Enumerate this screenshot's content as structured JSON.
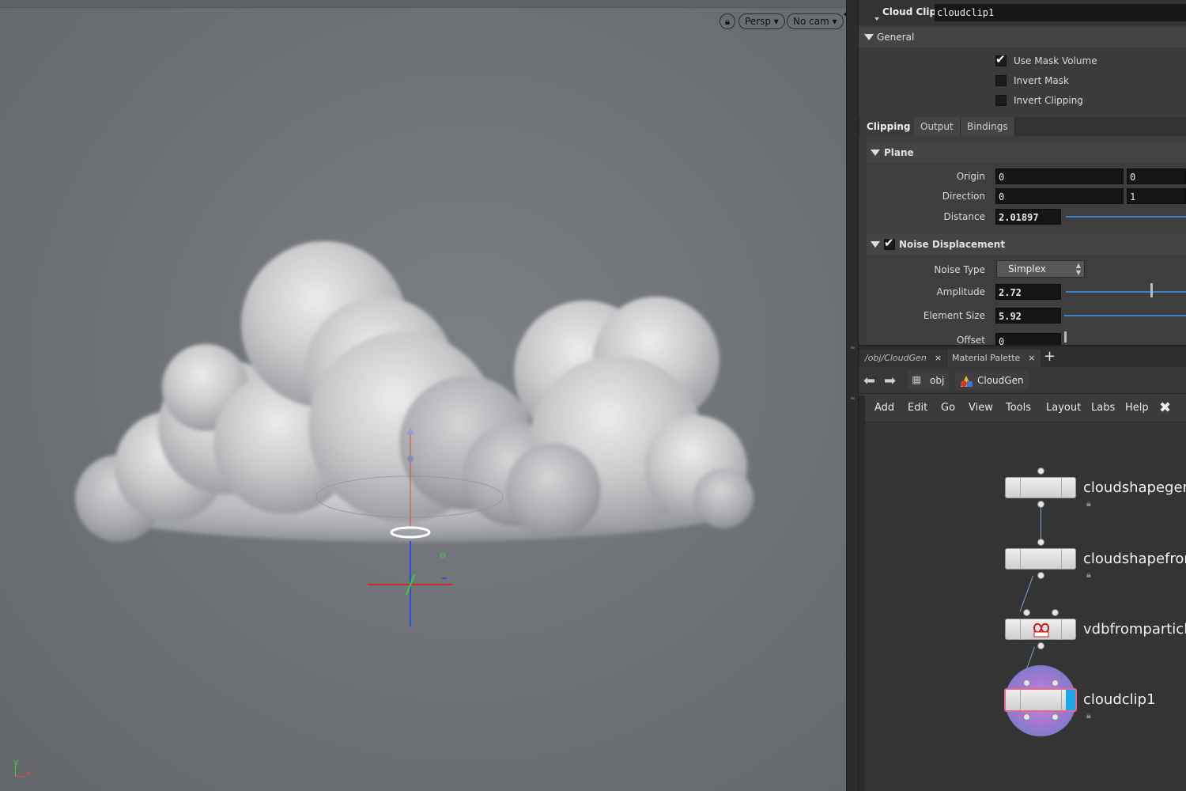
{
  "viewport": {
    "persp_label": "Persp ▾",
    "cam_label": "No cam ▾",
    "axis_y": "y",
    "axis_x": "x"
  },
  "params": {
    "op_type": "Cloud Clip",
    "op_name": "cloudclip1",
    "general_label": "General",
    "use_mask_volume": {
      "label": "Use Mask Volume",
      "checked": true
    },
    "invert_mask": {
      "label": "Invert Mask",
      "checked": false
    },
    "invert_clipping": {
      "label": "Invert Clipping",
      "checked": false
    },
    "tabs": [
      "Clipping",
      "Output",
      "Bindings"
    ],
    "plane_label": "Plane",
    "origin": {
      "label": "Origin",
      "x": "0",
      "y": "0"
    },
    "direction": {
      "label": "Direction",
      "x": "0",
      "y": "1"
    },
    "distance": {
      "label": "Distance",
      "value": "2.01897"
    },
    "noise_label": "Noise Displacement",
    "noise_type": {
      "label": "Noise Type",
      "value": "Simplex"
    },
    "amplitude": {
      "label": "Amplitude",
      "value": "2.72"
    },
    "element_size": {
      "label": "Element Size",
      "value": "5.92"
    },
    "offset": {
      "label": "Offset",
      "value": "0"
    }
  },
  "network": {
    "tabs": [
      {
        "label": "/obj/CloudGen",
        "close": "×"
      },
      {
        "label": "Material Palette",
        "close": "×"
      }
    ],
    "plus": "+",
    "path": [
      "obj",
      "CloudGen"
    ],
    "menu": [
      "Add",
      "Edit",
      "Go",
      "View",
      "Tools",
      "Layout",
      "Labs",
      "Help"
    ],
    "nodes": [
      {
        "name": "cloudshapegen"
      },
      {
        "name": "cloudshapefrom"
      },
      {
        "name": "vdbfromparticle"
      },
      {
        "name": "cloudclip1"
      }
    ]
  },
  "colors": {
    "accent": "#3f7fc4",
    "selected_node_ring": "#5d7fc8",
    "axis_x": "#e24848",
    "axis_y": "#3ad23a",
    "axis_z": "#2a4fd8"
  }
}
